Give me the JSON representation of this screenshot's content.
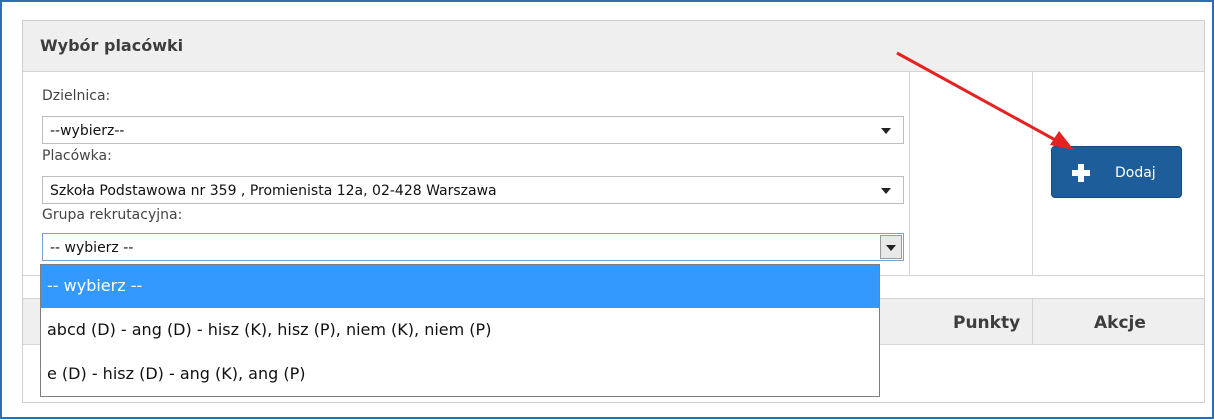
{
  "panel": {
    "title": "Wybór placówki"
  },
  "form": {
    "district": {
      "label": "Dzielnica:",
      "value": "--wybierz--"
    },
    "facility": {
      "label": "Placówka:",
      "value": "Szkoła Podstawowa nr 359 , Promienista 12a, 02-428 Warszawa"
    },
    "group": {
      "label": "Grupa rekrutacyjna:",
      "value": "-- wybierz --"
    }
  },
  "add_button": {
    "label": "Dodaj",
    "icon": "plus-icon"
  },
  "table": {
    "columns": [
      "Punkty",
      "Akcje"
    ]
  },
  "dropdown": {
    "options": [
      "-- wybierz --",
      "abcd (D) - ang (D) - hisz (K), hisz (P), niem (K), niem (P)",
      "e (D) - hisz (D) - ang (K), ang (P)"
    ],
    "selected_index": 0
  },
  "colors": {
    "accent": "#1d5d99",
    "highlight": "#3399ff",
    "annotation_arrow": "#e52222"
  }
}
